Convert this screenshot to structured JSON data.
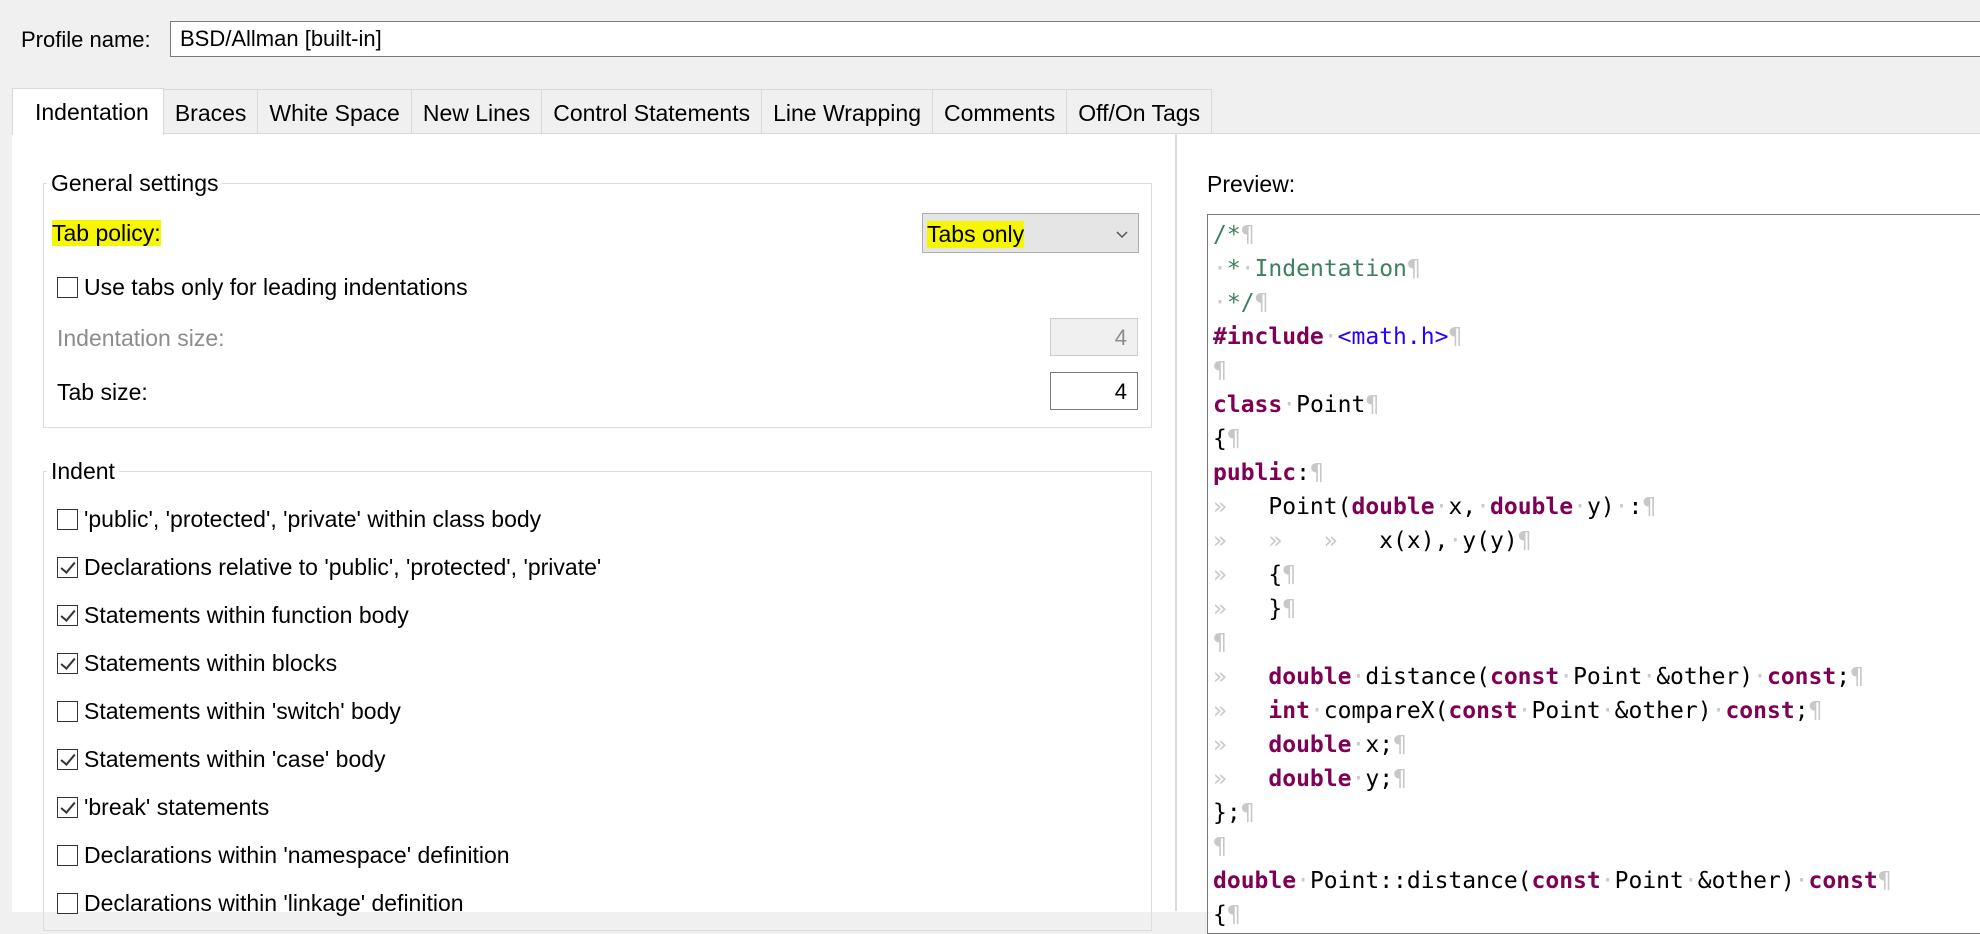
{
  "profile": {
    "label": "Profile name:",
    "value": "BSD/Allman [built-in]"
  },
  "tabs": [
    {
      "label": "Indentation",
      "active": true
    },
    {
      "label": "Braces"
    },
    {
      "label": "White Space"
    },
    {
      "label": "New Lines"
    },
    {
      "label": "Control Statements"
    },
    {
      "label": "Line Wrapping"
    },
    {
      "label": "Comments"
    },
    {
      "label": "Off/On Tags"
    }
  ],
  "general": {
    "title": "General settings",
    "tab_policy_label": "Tab policy:",
    "tab_policy_value": "Tabs only",
    "use_tabs_leading_label": "Use tabs only for leading indentations",
    "use_tabs_leading_checked": false,
    "indentation_size_label": "Indentation size:",
    "indentation_size_value": "4",
    "tab_size_label": "Tab size:",
    "tab_size_value": "4"
  },
  "indent": {
    "title": "Indent",
    "items": [
      {
        "label": "'public', 'protected', 'private' within class body",
        "checked": false
      },
      {
        "label": "Declarations relative to 'public', 'protected', 'private'",
        "checked": true
      },
      {
        "label": "Statements within function body",
        "checked": true
      },
      {
        "label": "Statements within blocks",
        "checked": true
      },
      {
        "label": "Statements within 'switch' body",
        "checked": false
      },
      {
        "label": "Statements within 'case' body",
        "checked": true
      },
      {
        "label": "'break' statements",
        "checked": true
      },
      {
        "label": "Declarations within 'namespace' definition",
        "checked": false
      },
      {
        "label": "Declarations within 'linkage' definition",
        "checked": false
      }
    ]
  },
  "preview": {
    "label": "Preview:",
    "code_lines": [
      [
        [
          "c",
          "/*"
        ],
        [
          "w",
          "¶"
        ]
      ],
      [
        [
          "w",
          "·"
        ],
        [
          "c",
          "*"
        ],
        [
          "w",
          "·"
        ],
        [
          "c",
          "Indentation"
        ],
        [
          "w",
          "¶"
        ]
      ],
      [
        [
          "w",
          "·"
        ],
        [
          "c",
          "*/"
        ],
        [
          "w",
          "¶"
        ]
      ],
      [
        [
          "k",
          "#include"
        ],
        [
          "w",
          "·"
        ],
        [
          "s",
          "<math.h>"
        ],
        [
          "w",
          "¶"
        ]
      ],
      [
        [
          "w",
          "¶"
        ]
      ],
      [
        [
          "k",
          "class"
        ],
        [
          "w",
          "·"
        ],
        [
          "t",
          "Point"
        ],
        [
          "w",
          "¶"
        ]
      ],
      [
        [
          "t",
          "{"
        ],
        [
          "w",
          "¶"
        ]
      ],
      [
        [
          "k",
          "public"
        ],
        [
          "t",
          ":"
        ],
        [
          "w",
          "¶"
        ]
      ],
      [
        [
          "w",
          "»   "
        ],
        [
          "t",
          "Point("
        ],
        [
          "k",
          "double"
        ],
        [
          "w",
          "·"
        ],
        [
          "t",
          "x,"
        ],
        [
          "w",
          "·"
        ],
        [
          "k",
          "double"
        ],
        [
          "w",
          "·"
        ],
        [
          "t",
          "y)"
        ],
        [
          "w",
          "·"
        ],
        [
          "t",
          ":"
        ],
        [
          "w",
          "¶"
        ]
      ],
      [
        [
          "w",
          "»   »   »   "
        ],
        [
          "t",
          "x(x),"
        ],
        [
          "w",
          "·"
        ],
        [
          "t",
          "y(y)"
        ],
        [
          "w",
          "¶"
        ]
      ],
      [
        [
          "w",
          "»   "
        ],
        [
          "t",
          "{"
        ],
        [
          "w",
          "¶"
        ]
      ],
      [
        [
          "w",
          "»   "
        ],
        [
          "t",
          "}"
        ],
        [
          "w",
          "¶"
        ]
      ],
      [
        [
          "w",
          "¶"
        ]
      ],
      [
        [
          "w",
          "»   "
        ],
        [
          "k",
          "double"
        ],
        [
          "w",
          "·"
        ],
        [
          "t",
          "distance("
        ],
        [
          "k",
          "const"
        ],
        [
          "w",
          "·"
        ],
        [
          "t",
          "Point"
        ],
        [
          "w",
          "·"
        ],
        [
          "t",
          "&other)"
        ],
        [
          "w",
          "·"
        ],
        [
          "k",
          "const"
        ],
        [
          "t",
          ";"
        ],
        [
          "w",
          "¶"
        ]
      ],
      [
        [
          "w",
          "»   "
        ],
        [
          "k",
          "int"
        ],
        [
          "w",
          "·"
        ],
        [
          "t",
          "compareX("
        ],
        [
          "k",
          "const"
        ],
        [
          "w",
          "·"
        ],
        [
          "t",
          "Point"
        ],
        [
          "w",
          "·"
        ],
        [
          "t",
          "&other)"
        ],
        [
          "w",
          "·"
        ],
        [
          "k",
          "const"
        ],
        [
          "t",
          ";"
        ],
        [
          "w",
          "¶"
        ]
      ],
      [
        [
          "w",
          "»   "
        ],
        [
          "k",
          "double"
        ],
        [
          "w",
          "·"
        ],
        [
          "t",
          "x;"
        ],
        [
          "w",
          "¶"
        ]
      ],
      [
        [
          "w",
          "»   "
        ],
        [
          "k",
          "double"
        ],
        [
          "w",
          "·"
        ],
        [
          "t",
          "y;"
        ],
        [
          "w",
          "¶"
        ]
      ],
      [
        [
          "t",
          "};"
        ],
        [
          "w",
          "¶"
        ]
      ],
      [
        [
          "w",
          "¶"
        ]
      ],
      [
        [
          "k",
          "double"
        ],
        [
          "w",
          "·"
        ],
        [
          "t",
          "Point::distance("
        ],
        [
          "k",
          "const"
        ],
        [
          "w",
          "·"
        ],
        [
          "t",
          "Point"
        ],
        [
          "w",
          "·"
        ],
        [
          "t",
          "&other)"
        ],
        [
          "w",
          "·"
        ],
        [
          "k",
          "const"
        ],
        [
          "w",
          "¶"
        ]
      ],
      [
        [
          "t",
          "{"
        ],
        [
          "w",
          "¶"
        ]
      ]
    ]
  },
  "colors": {
    "highlight": "#f6f600",
    "keyword": "#7f0055",
    "comment": "#3f7f5f",
    "string": "#2a00ff",
    "whitespace_marker": "#c8c8c8"
  },
  "icons": {
    "dropdown": "chevron-down-icon",
    "check": "checkmark-icon"
  }
}
